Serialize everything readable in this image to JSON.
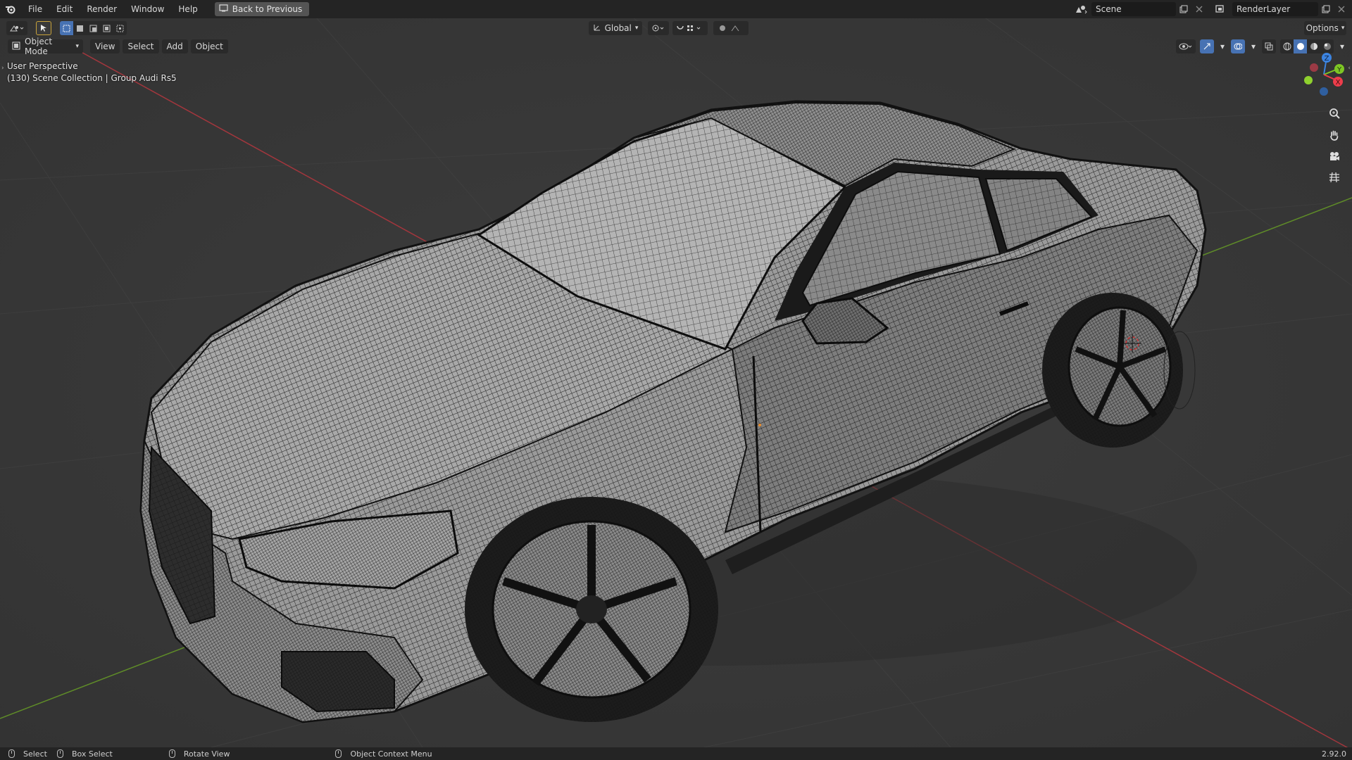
{
  "topbar": {
    "menus": [
      "File",
      "Edit",
      "Render",
      "Window",
      "Help"
    ],
    "back_button": "Back to Previous",
    "scene_name": "Scene",
    "render_layer": "RenderLayer"
  },
  "viewport_header": {
    "transform_orientation": "Global",
    "options_label": "Options",
    "mode": "Object Mode",
    "menus": [
      "View",
      "Select",
      "Add",
      "Object"
    ]
  },
  "overlay": {
    "perspective": "User Perspective",
    "collection": "(130) Scene Collection | Group Audi Rs5"
  },
  "gizmo": {
    "x_label": "X",
    "y_label": "Y",
    "z_label": "Z",
    "x_color": "#ed3d4b",
    "y_color": "#7ec724",
    "z_color": "#3c84e1"
  },
  "statusbar": {
    "select": "Select",
    "box_select": "Box Select",
    "rotate_view": "Rotate View",
    "context_menu": "Object Context Menu",
    "version": "2.92.0"
  },
  "icons": [
    "blender-logo-icon",
    "screen-icon",
    "editor-type-icon",
    "cursor-icon",
    "orientation-icon",
    "pivot-icon",
    "snap-icon",
    "proportional-icon",
    "visibility-icon",
    "gizmo-icon",
    "overlay-icon",
    "xray-icon",
    "wireframe-shading-icon",
    "solid-shading-icon",
    "material-shading-icon",
    "rendered-shading-icon",
    "zoom-icon",
    "hand-icon",
    "camera-icon",
    "grid-icon"
  ]
}
